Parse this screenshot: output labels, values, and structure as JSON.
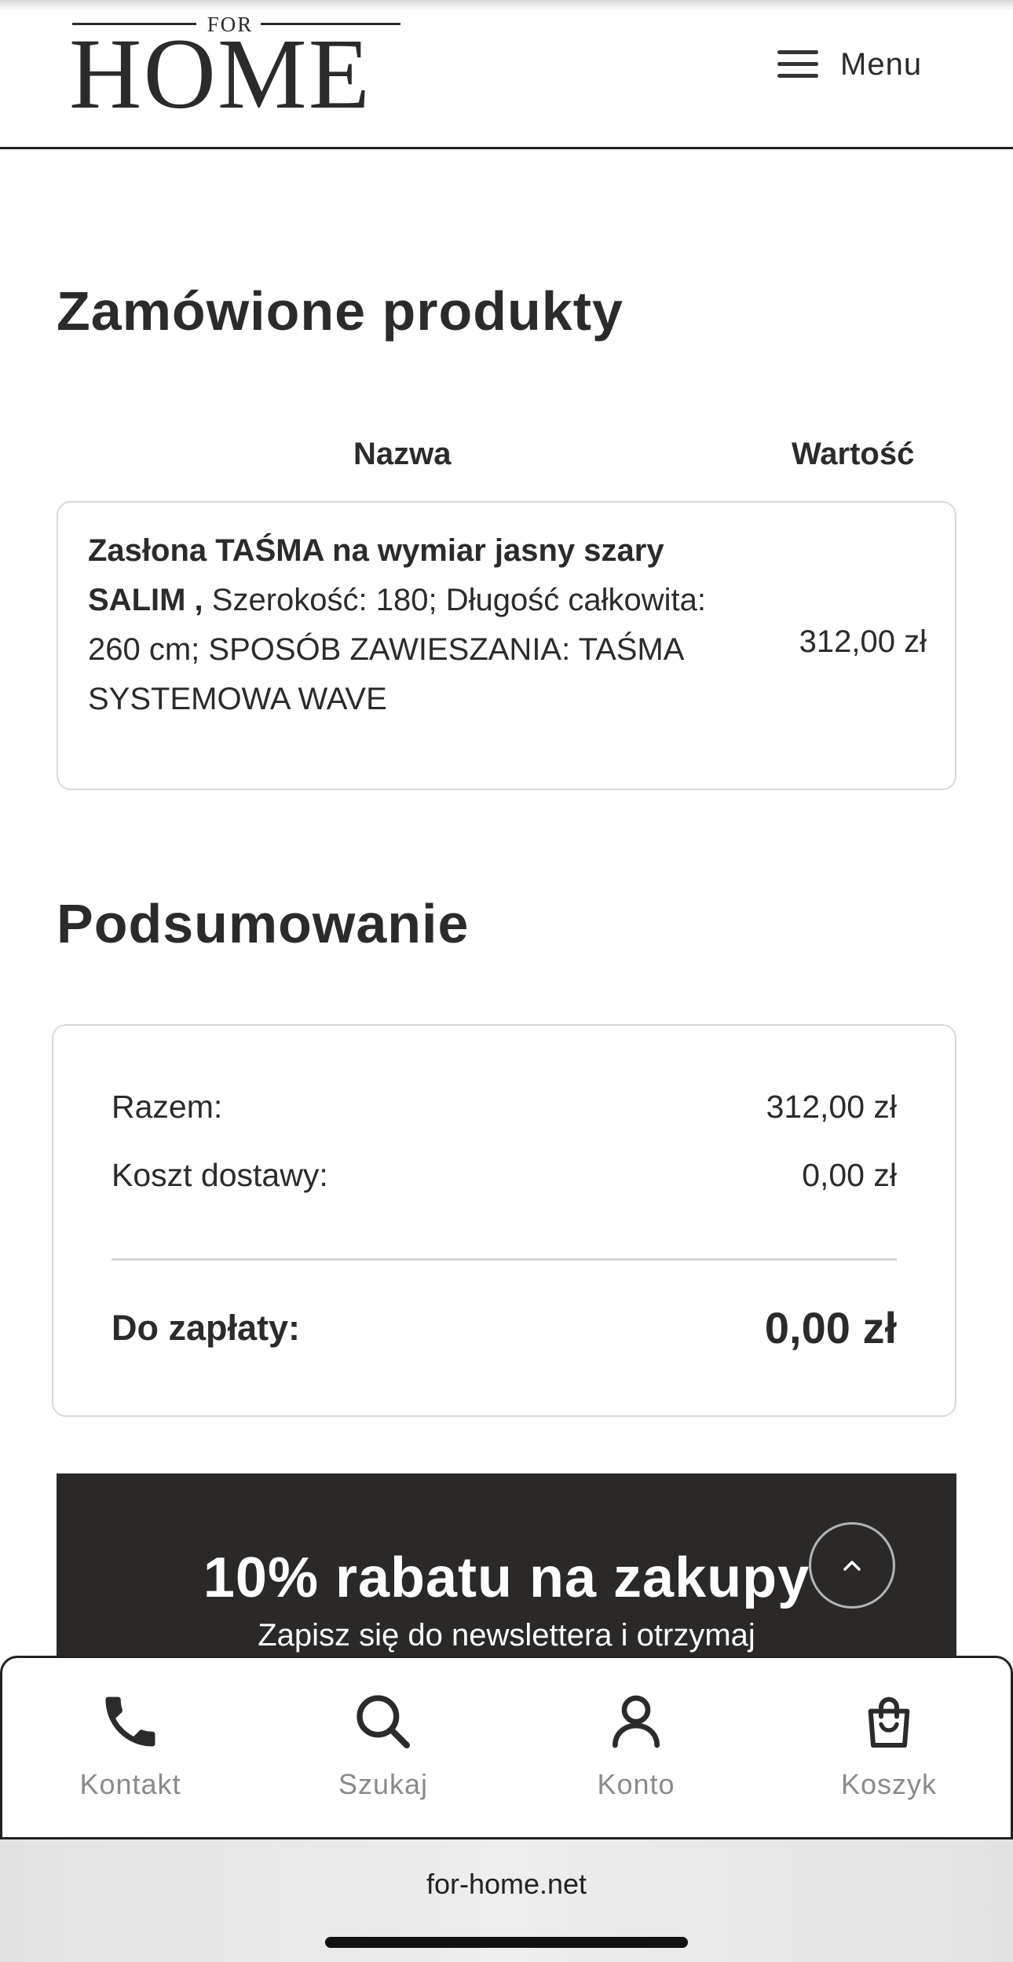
{
  "brand": {
    "logo_top": "FOR",
    "logo_main": "HOME"
  },
  "header": {
    "menu_label": "Menu"
  },
  "ordered": {
    "title": "Zamówione produkty",
    "col_name": "Nazwa",
    "col_value": "Wartość",
    "items": [
      {
        "name_bold": "Zasłona TAŚMA na wymiar jasny szary SALIM ,",
        "details": "Szerokość: 180; Długość całkowita: 260 cm; SPOSÓB ZAWIESZANIA: TAŚMA SYSTEMOWA WAVE",
        "price": "312,00 zł"
      }
    ]
  },
  "summary": {
    "title": "Podsumowanie",
    "subtotal_label": "Razem:",
    "subtotal_value": "312,00 zł",
    "shipping_label": "Koszt dostawy:",
    "shipping_value": "0,00 zł",
    "total_label": "Do zapłaty:",
    "total_value": "0,00 zł"
  },
  "newsletter": {
    "title": "10% rabatu na zakupy",
    "subtitle": "Zapisz się do newslettera i otrzymaj"
  },
  "bottom_nav": {
    "items": [
      {
        "label": "Kontakt",
        "icon": "phone-icon"
      },
      {
        "label": "Szukaj",
        "icon": "search-icon"
      },
      {
        "label": "Konto",
        "icon": "user-icon"
      },
      {
        "label": "Koszyk",
        "icon": "shopping-bag-icon"
      }
    ]
  },
  "browser": {
    "url": "for-home.net"
  },
  "colors": {
    "text": "#2b2b2b",
    "dark_banner": "#2a2928",
    "muted": "#8a8a8a",
    "border": "#d9d9d9"
  }
}
